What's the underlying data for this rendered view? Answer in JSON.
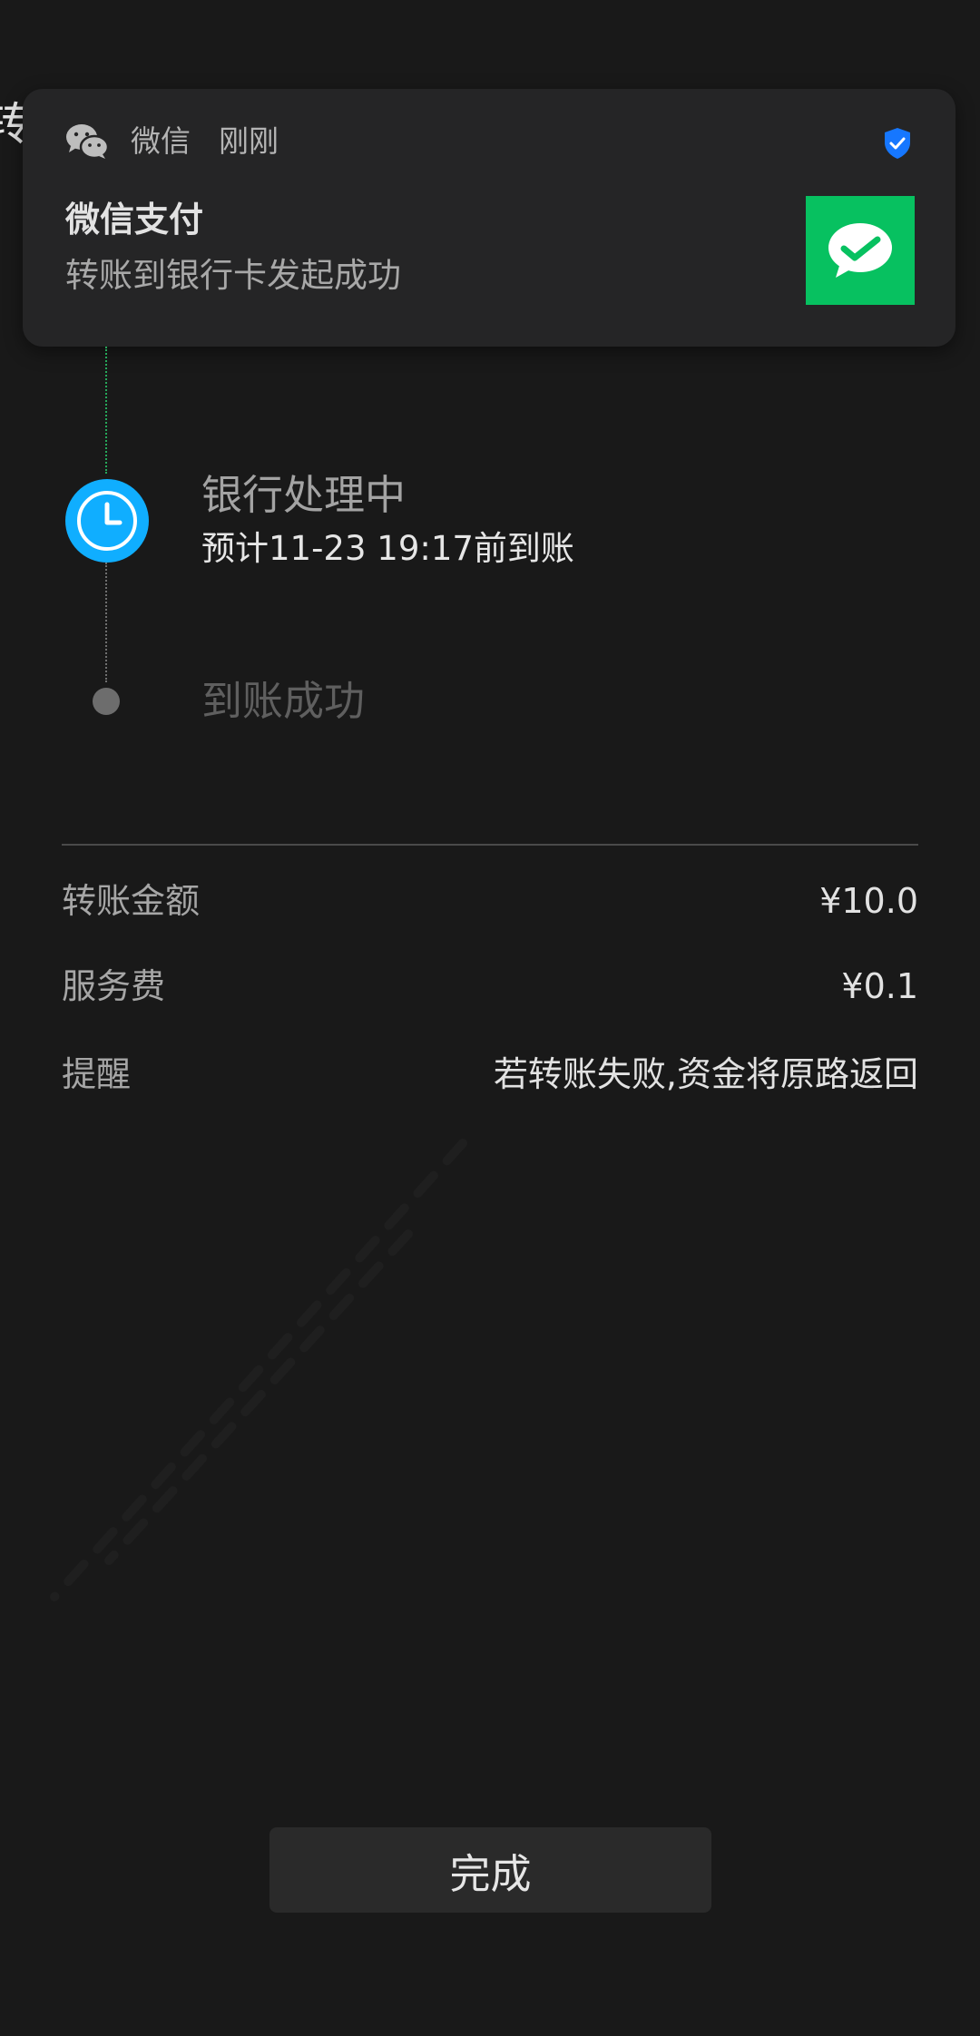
{
  "page": {
    "title_partial": "转"
  },
  "notification": {
    "app_name": "微信",
    "time": "刚刚",
    "title": "微信支付",
    "body": "转账到银行卡发起成功",
    "icons": {
      "app": "wechat-icon",
      "security": "shield-check-icon",
      "pay": "wechat-pay-icon"
    }
  },
  "timeline": {
    "steps": [
      {
        "title": "银行处理中",
        "subtitle": "预计11-23 19:17前到账",
        "status": "in-progress",
        "icon": "clock-icon"
      },
      {
        "title": "到账成功",
        "status": "pending"
      }
    ]
  },
  "details": {
    "amount_label": "转账金额",
    "amount_value": "¥10.0",
    "fee_label": "服务费",
    "fee_value": "¥0.1",
    "tip_label": "提醒",
    "tip_value": "若转账失败,资金将原路返回"
  },
  "actions": {
    "done_label": "完成"
  },
  "colors": {
    "background": "#191919",
    "notification_bg": "#252526",
    "wechat_green": "#07c160",
    "clock_blue": "#10aeff",
    "shield_blue": "#1677ff",
    "button_bg": "#2a2a2a"
  }
}
